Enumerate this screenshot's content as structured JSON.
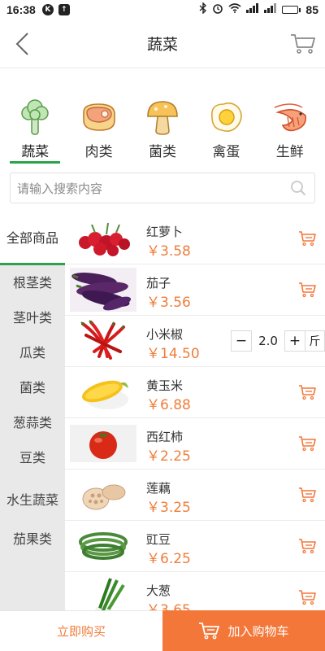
{
  "status_bar": {
    "time": "16:38",
    "battery": "85",
    "battery_level": 0.85
  },
  "header": {
    "title": "蔬菜"
  },
  "categories": [
    {
      "label": "蔬菜",
      "icon": "broccoli-icon",
      "active": true
    },
    {
      "label": "肉类",
      "icon": "meat-icon",
      "active": false
    },
    {
      "label": "菌类",
      "icon": "mushroom-icon",
      "active": false
    },
    {
      "label": "禽蛋",
      "icon": "egg-icon",
      "active": false
    },
    {
      "label": "生鲜",
      "icon": "shrimp-icon",
      "active": false
    }
  ],
  "search": {
    "placeholder": "请输入搜索内容"
  },
  "sidebar": {
    "items": [
      {
        "label": "全部商品",
        "active": true
      },
      {
        "label": "根茎类"
      },
      {
        "label": "茎叶类"
      },
      {
        "label": "瓜类"
      },
      {
        "label": "菌类"
      },
      {
        "label": "葱蒜类"
      },
      {
        "label": "豆类"
      },
      {
        "label": "水生蔬菜"
      },
      {
        "label": "茄果类"
      }
    ]
  },
  "products": [
    {
      "name": "红萝卜",
      "price": "￥3.58",
      "image": "radish-photo"
    },
    {
      "name": "茄子",
      "price": "￥3.56",
      "image": "eggplant-photo"
    },
    {
      "name": "小米椒",
      "price": "￥14.50",
      "image": "chili-photo",
      "quantity": "2.0",
      "unit": "斤",
      "stepper": true
    },
    {
      "name": "黄玉米",
      "price": "￥6.88",
      "image": "corn-photo"
    },
    {
      "name": "西红柿",
      "price": "￥2.25",
      "image": "tomato-photo"
    },
    {
      "name": "莲藕",
      "price": "￥3.25",
      "image": "lotus-root-photo"
    },
    {
      "name": "豇豆",
      "price": "￥6.25",
      "image": "long-bean-photo"
    },
    {
      "name": "大葱",
      "price": "￥3.65",
      "image": "scallion-photo"
    }
  ],
  "stepper": {
    "minus": "−",
    "plus": "+"
  },
  "bottom": {
    "buy_now": "立即购买",
    "add_to_cart": "加入购物车"
  },
  "colors": {
    "accent": "#f4773a",
    "price": "#ef7d3a",
    "active_green": "#2aa34a",
    "sidebar_bg": "#e9e9e9"
  }
}
